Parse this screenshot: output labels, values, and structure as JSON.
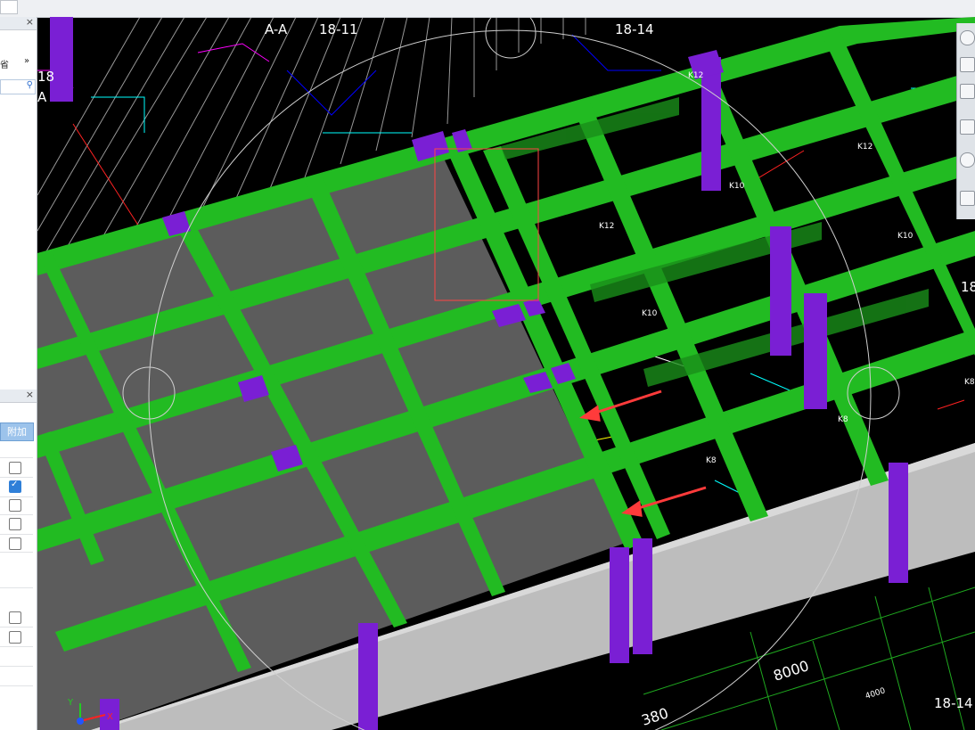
{
  "left_panel": {
    "header_close": "×",
    "upper_label": "省",
    "more_glyph": "»",
    "lower_header_close": "×",
    "add_button": "附加",
    "checkboxes": [
      false,
      true,
      false,
      false,
      false,
      false,
      false
    ]
  },
  "viewport": {
    "labels": {
      "section": "A-A",
      "axis_1": "18-11",
      "axis_2": "18-14",
      "axis_3": "18-14",
      "dim_1": "8000",
      "dim_2": "380",
      "dim_3": "4000",
      "left_a": "A",
      "left_18": "18",
      "right_18": "18-"
    },
    "beam_tags": [
      "K12",
      "K12",
      "K10",
      "K10",
      "K8",
      "K8",
      "K8",
      "K10",
      "K12"
    ],
    "axis_icon": {
      "x": "X",
      "y": "Y"
    }
  },
  "colors": {
    "beam": "#22bb22",
    "column": "#7a1fd4",
    "slab": "#5c5c5c",
    "wall": "#bdbdbd",
    "background": "#000000"
  }
}
